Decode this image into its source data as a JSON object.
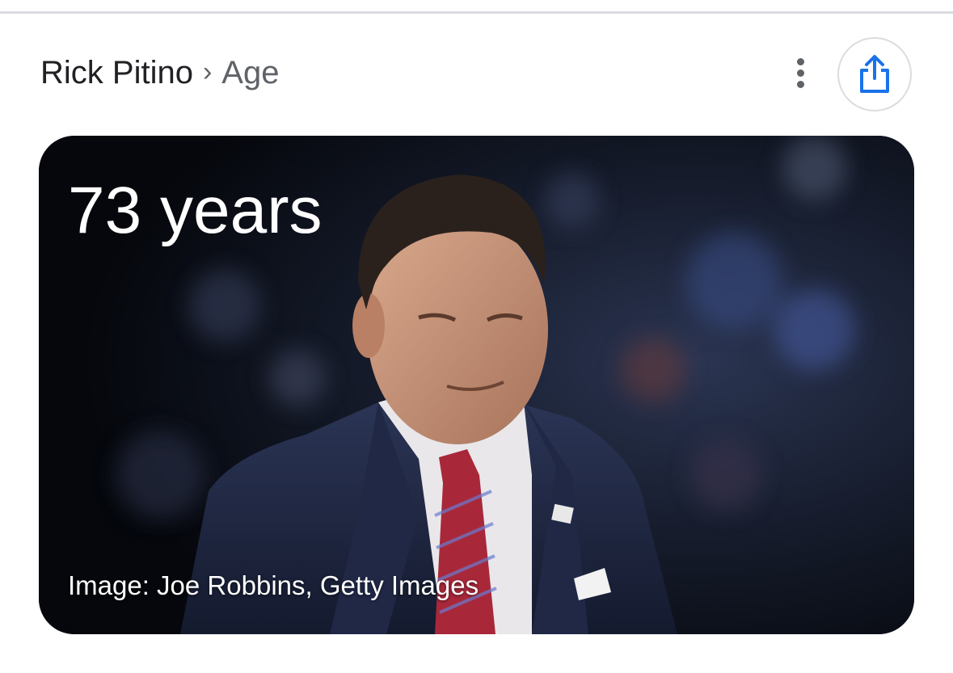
{
  "breadcrumb": {
    "subject": "Rick Pitino",
    "separator": "›",
    "current": "Age"
  },
  "actions": {
    "more_icon": "more-vert-icon",
    "share_icon": "share-icon"
  },
  "answer_card": {
    "age_value": "73 years",
    "image_credit": "Image: Joe Robbins, Getty Images",
    "image_alt": "Rick Pitino"
  },
  "colors": {
    "text_primary": "#202124",
    "text_secondary": "#5f6368",
    "accent_blue": "#1a73e8",
    "divider": "#dadce0"
  }
}
